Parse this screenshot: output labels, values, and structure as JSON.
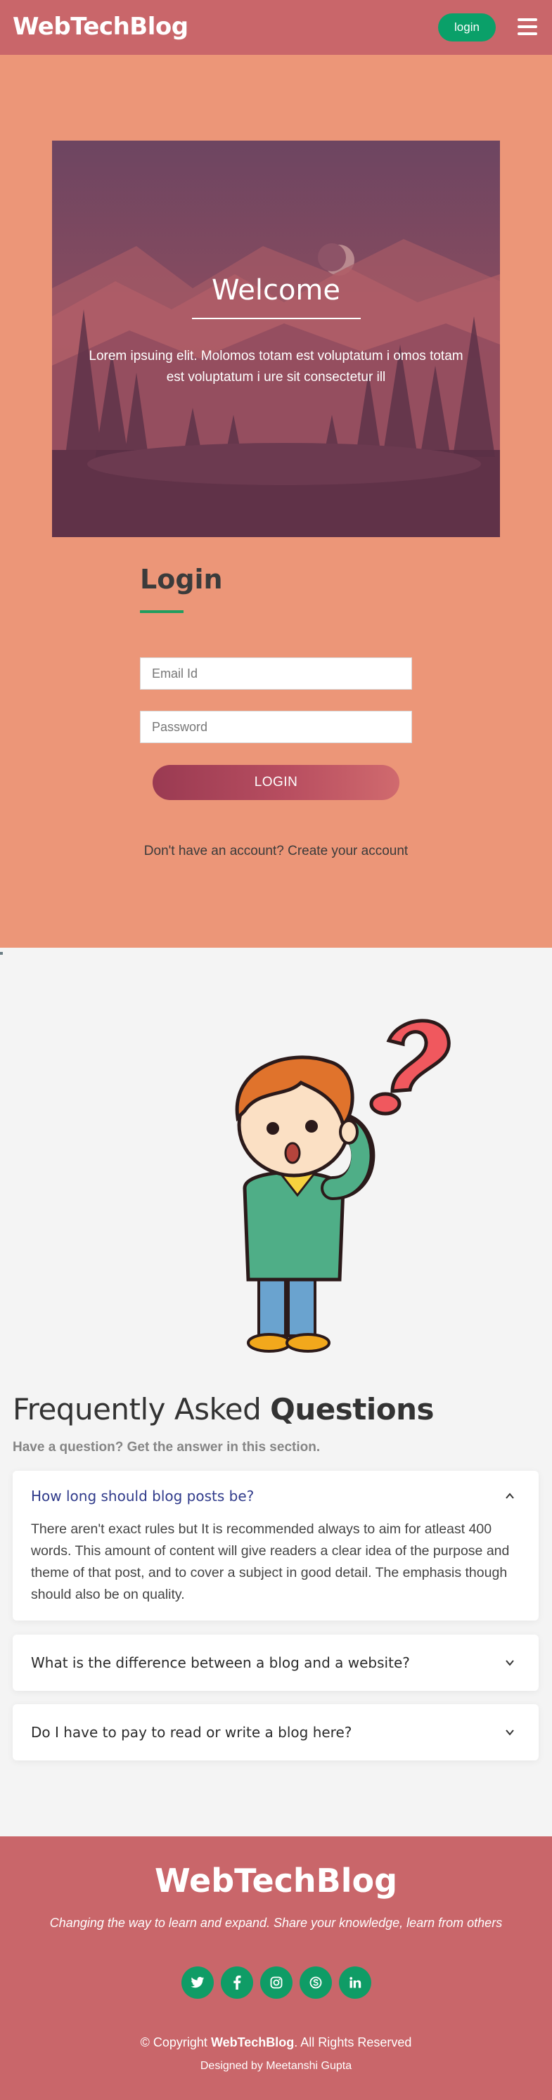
{
  "navbar": {
    "brand": "WebTechBlog",
    "login_label": "login",
    "menu_icon": "hamburger-icon"
  },
  "hero": {
    "title": "Welcome",
    "text": "Lorem ipsuing elit. Molomos totam est voluptatum i omos totam est voluptatum i ure sit consectetur ill"
  },
  "login": {
    "title": "Login",
    "email_placeholder": "Email Id",
    "password_placeholder": "Password",
    "button_label": "LOGIN",
    "signup_prefix": "Don't have an account?",
    "signup_link": "Create your account"
  },
  "faq": {
    "heading_light": "Frequently Asked",
    "heading_bold": "Questions",
    "subheading": "Have a question? Get the answer in this section.",
    "items": [
      {
        "question": "How long should blog posts be?",
        "answer": "There aren't exact rules but It is recommended always to aim for atleast 400 words. This amount of content will give readers a clear idea of the purpose and theme of that post, and to cover a subject in good detail. The emphasis though should also be on quality.",
        "expanded": true
      },
      {
        "question": "What is the difference between a blog and a website?",
        "expanded": false
      },
      {
        "question": "Do I have to pay to read or write a blog here?",
        "expanded": false
      }
    ]
  },
  "footer": {
    "brand": "WebTechBlog",
    "tagline": "Changing the way to learn and expand. Share your knowledge, learn from others",
    "social_icons": [
      "twitter-icon",
      "facebook-icon",
      "instagram-icon",
      "skype-icon",
      "linkedin-icon"
    ],
    "copyright_prefix": "© Copyright",
    "copyright_brand": "WebTechBlog",
    "copyright_suffix": ". All Rights Reserved",
    "designed_by": "Designed by Meetanshi Gupta"
  },
  "colors": {
    "navbar": "#c9666a",
    "login_bg": "#ec9678",
    "accent_green": "#0aa069",
    "faq_active": "#2f3a8a"
  }
}
